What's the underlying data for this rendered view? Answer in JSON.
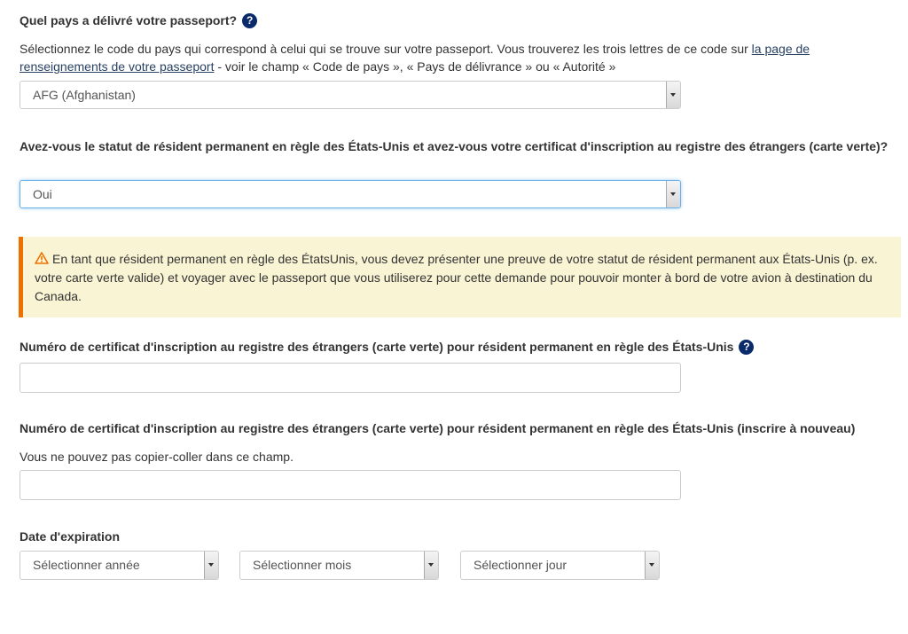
{
  "passport_country": {
    "label": "Quel pays a délivré votre passeport?",
    "help_icon": "?",
    "description_before_link": "Sélectionnez le code du pays qui correspond à celui qui se trouve sur votre passeport. Vous trouverez les trois lettres de ce code sur ",
    "description_link": "la page de renseignements de votre passeport",
    "description_after_link": " - voir le champ « Code de pays », « Pays de délivrance » ou « Autorité »",
    "selected_value": "AFG (Afghanistan)"
  },
  "permanent_resident": {
    "label": "Avez-vous le statut de résident permanent en règle des États-Unis et avez-vous votre certificat d'inscription au registre des étrangers (carte verte)?",
    "selected_value": "Oui"
  },
  "warning": {
    "icon": "warning-triangle-icon",
    "text": "En tant que résident permanent en règle des ÉtatsUnis, vous devez présenter une preuve de votre statut de résident permanent aux États-Unis (p. ex. votre carte verte valide) et voyager avec le passeport que vous utiliserez pour cette demande pour pouvoir monter à bord de votre avion à destination du Canada."
  },
  "green_card_number": {
    "label": "Numéro de certificat d'inscription au registre des étrangers (carte verte) pour résident permanent en règle des États-Unis",
    "help_icon": "?",
    "value": ""
  },
  "green_card_number_confirm": {
    "label": "Numéro de certificat d'inscription au registre des étrangers (carte verte) pour résident permanent en règle des États-Unis (inscrire à nouveau)",
    "hint": "Vous ne pouvez pas copier-coller dans ce champ.",
    "value": ""
  },
  "expiry_date": {
    "label": "Date d'expiration",
    "year_placeholder": "Sélectionner année",
    "month_placeholder": "Sélectionner mois",
    "day_placeholder": "Sélectionner jour"
  },
  "colors": {
    "help_icon_bg": "#0a2a6b",
    "warning_bg": "#f9f4d4",
    "warning_border": "#ee7100",
    "link": "#284162"
  }
}
